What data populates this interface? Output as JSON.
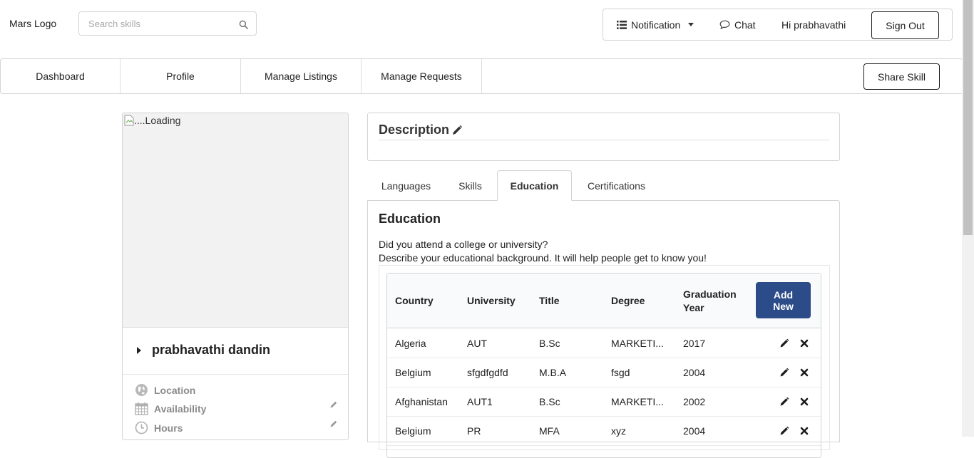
{
  "header": {
    "logo": "Mars Logo",
    "search_placeholder": "Search skills",
    "notification_label": "Notification",
    "chat_label": "Chat",
    "greeting": "Hi prabhavathi",
    "signout_label": "Sign Out"
  },
  "nav": {
    "items": [
      {
        "label": "Dashboard"
      },
      {
        "label": "Profile"
      },
      {
        "label": "Manage Listings"
      },
      {
        "label": "Manage Requests"
      }
    ],
    "share_label": "Share Skill"
  },
  "profile": {
    "image_alt": "....Loading",
    "name": "prabhavathi dandin",
    "location_label": "Location",
    "availability_label": "Availability",
    "hours_label": "Hours"
  },
  "description": {
    "title": "Description"
  },
  "tabs": [
    {
      "label": "Languages"
    },
    {
      "label": "Skills"
    },
    {
      "label": "Education"
    },
    {
      "label": "Certifications"
    }
  ],
  "education": {
    "heading": "Education",
    "line1": "Did you attend a college or university?",
    "line2": "Describe your educational background. It will help people get to know you!",
    "columns": [
      "Country",
      "University",
      "Title",
      "Degree",
      "Graduation",
      "Year"
    ],
    "add_new_line1": "Add",
    "add_new_line2": "New",
    "rows": [
      {
        "country": "Algeria",
        "university": "AUT",
        "title": "B.Sc",
        "degree": "MARKETI...",
        "year": "2017"
      },
      {
        "country": "Belgium",
        "university": "sfgdfgdfd",
        "title": "M.B.A",
        "degree": "fsgd",
        "year": "2004"
      },
      {
        "country": "Afghanistan",
        "university": "AUT1",
        "title": "B.Sc",
        "degree": "MARKETI...",
        "year": "2002"
      },
      {
        "country": "Belgium",
        "university": "PR",
        "title": "MFA",
        "degree": "xyz",
        "year": "2004"
      }
    ]
  },
  "colors": {
    "primary_button": "#2c4b89",
    "border": "#d4d4d5"
  }
}
